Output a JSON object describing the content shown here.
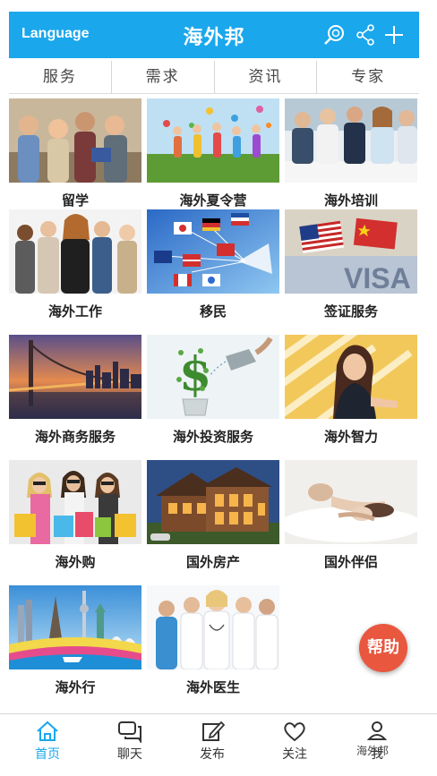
{
  "header": {
    "language": "Language",
    "title": "海外邦"
  },
  "tabs": [
    "服务",
    "需求",
    "资讯",
    "专家"
  ],
  "grid": [
    "留学",
    "海外夏令营",
    "海外培训",
    "海外工作",
    "移民",
    "签证服务",
    "海外商务服务",
    "海外投资服务",
    "海外智力",
    "海外购",
    "国外房产",
    "国外伴侣",
    "海外行",
    "海外医生"
  ],
  "fab": "帮助",
  "bottom_nav": [
    "首页",
    "聊天",
    "发布",
    "关注",
    "我"
  ],
  "watermark": "海外邦",
  "colors": {
    "primary": "#1aa7ec",
    "fab": "#e9573f"
  }
}
